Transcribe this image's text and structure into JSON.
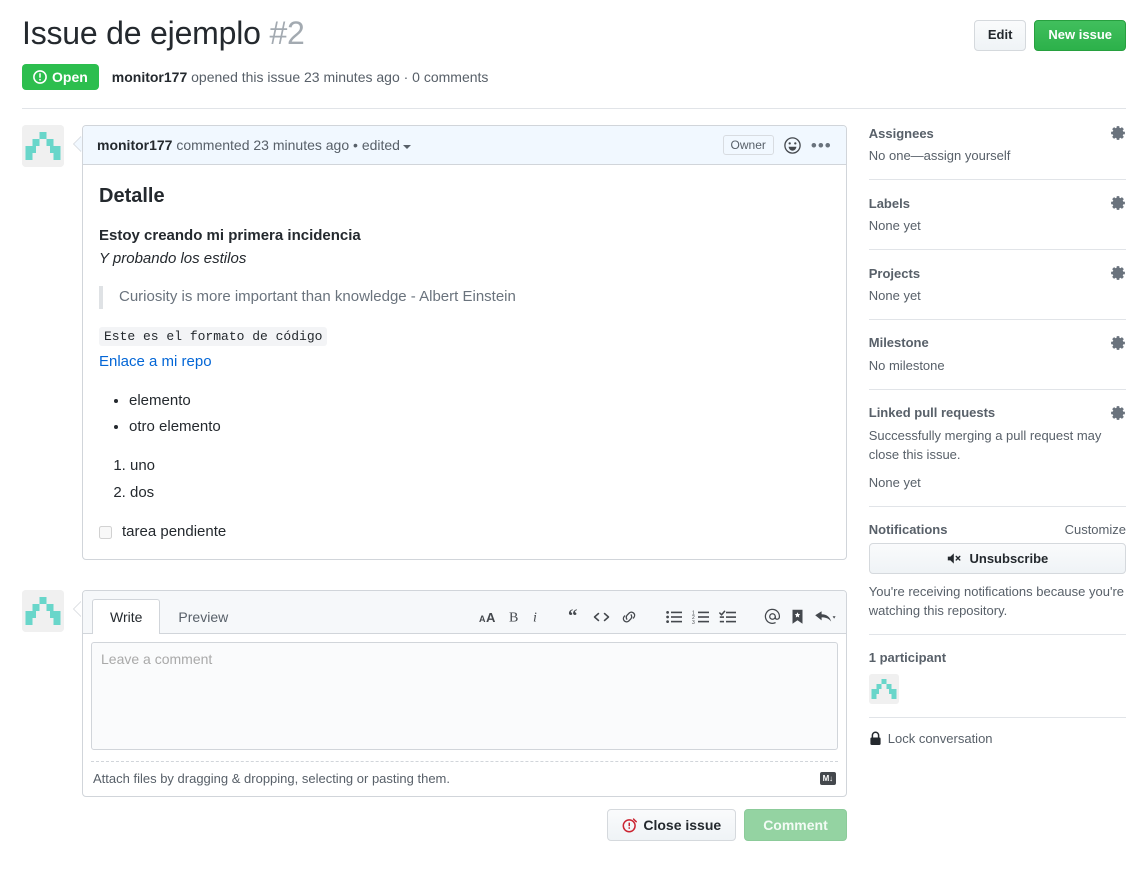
{
  "header": {
    "title": "Issue de ejemplo",
    "number": "#2",
    "edit_label": "Edit",
    "new_issue_label": "New issue",
    "state": "Open",
    "author": "monitor177",
    "meta_after_author": " opened this issue 23 minutes ago · 0 comments"
  },
  "comment": {
    "author": "monitor177",
    "commented_text": " commented 23 minutes ago • ",
    "edited_label": "edited",
    "owner_tag": "Owner",
    "body": {
      "heading": "Detalle",
      "strong_line": "Estoy creando mi primera incidencia",
      "em_line": "Y probando los estilos",
      "blockquote": "Curiosity is more important than knowledge - Albert Einstein",
      "code_span": "Este es el formato de código",
      "link_text": "Enlace a mi repo",
      "bullets": [
        "elemento",
        "otro elemento"
      ],
      "ordered": [
        "uno",
        "dos"
      ],
      "task": {
        "label": "tarea pendiente",
        "checked": false
      }
    }
  },
  "form": {
    "tabs": [
      {
        "label": "Write",
        "active": true
      },
      {
        "label": "Preview",
        "active": false
      }
    ],
    "toolbar": [
      {
        "name": "text-size-icon",
        "glyph": "AA"
      },
      {
        "name": "bold-icon",
        "glyph": "B"
      },
      {
        "name": "italic-icon",
        "glyph": "i"
      },
      {
        "name": "quote-icon",
        "glyph": "“"
      },
      {
        "name": "code-icon",
        "glyph": "<>"
      },
      {
        "name": "link-icon",
        "glyph": "link"
      },
      {
        "name": "unordered-list-icon",
        "glyph": "list"
      },
      {
        "name": "ordered-list-icon",
        "glyph": "numlist"
      },
      {
        "name": "task-list-icon",
        "glyph": "tasklist"
      },
      {
        "name": "mention-icon",
        "glyph": "@"
      },
      {
        "name": "saved-reply-icon",
        "glyph": "bookmark"
      },
      {
        "name": "reply-icon",
        "glyph": "reply"
      }
    ],
    "textarea_placeholder": "Leave a comment",
    "textarea_value": "",
    "attach_text": "Attach files by dragging & dropping, selecting or pasting them.",
    "markdown_badge": "M↓",
    "close_issue_label": "Close issue",
    "comment_label": "Comment"
  },
  "sidebar": {
    "sections": [
      {
        "title": "Assignees",
        "gear": true,
        "lines": [
          "No one—assign yourself"
        ]
      },
      {
        "title": "Labels",
        "gear": true,
        "lines": [
          "None yet"
        ]
      },
      {
        "title": "Projects",
        "gear": true,
        "lines": [
          "None yet"
        ]
      },
      {
        "title": "Milestone",
        "gear": true,
        "lines": [
          "No milestone"
        ]
      },
      {
        "title": "Linked pull requests",
        "gear": true,
        "lines": [
          "Successfully merging a pull request may close this issue.",
          "None yet"
        ]
      }
    ],
    "notifications": {
      "title": "Notifications",
      "customize_label": "Customize",
      "unsubscribe_label": "Unsubscribe",
      "description": "You're receiving notifications because you're watching this repository."
    },
    "participants": {
      "count_label": "1 participant"
    },
    "lock": {
      "label": "Lock conversation"
    }
  },
  "colors": {
    "green": "#2cbe4e",
    "link_blue": "#0366d6",
    "avatar_teal": "#69d6ca",
    "red": "#cb2431"
  }
}
